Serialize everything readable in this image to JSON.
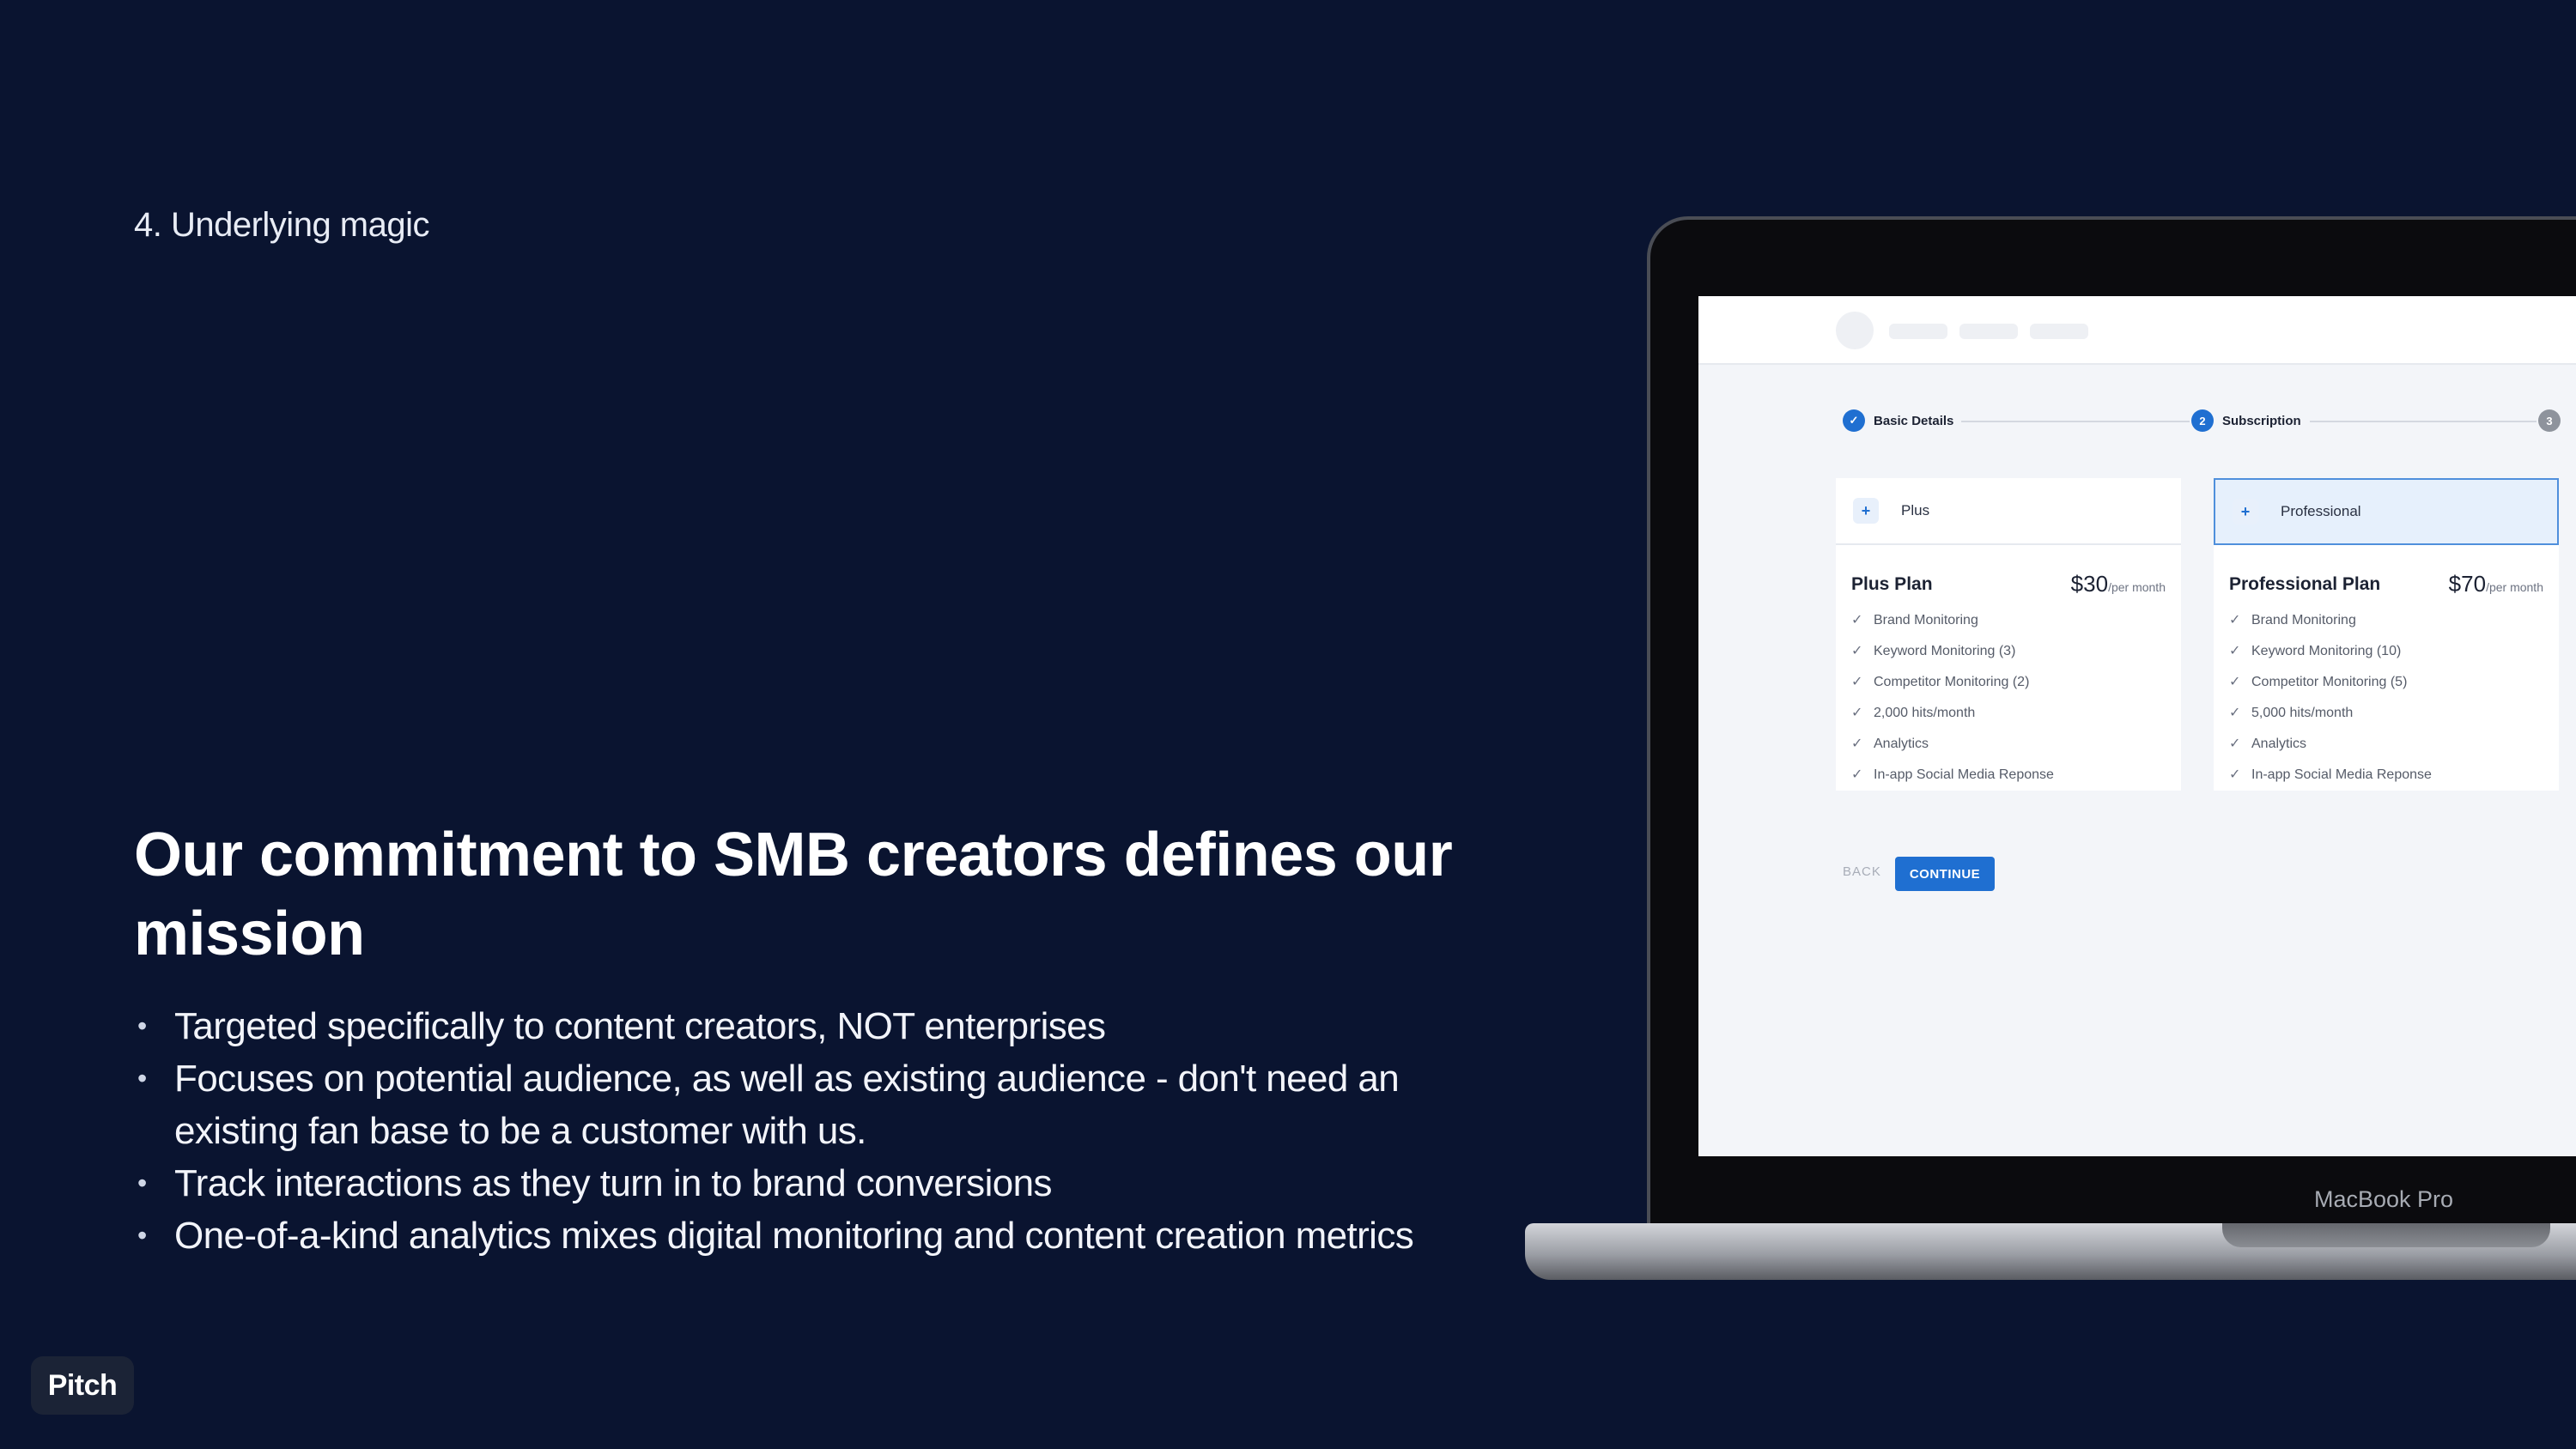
{
  "slide": {
    "eyebrow": "4. Underlying magic",
    "headline": "Our commitment to SMB creators defines our mission",
    "bullets": [
      "Targeted specifically to content creators, NOT enterprises",
      "Focuses on potential audience, as well as existing audience - don't need an existing fan base to be a customer with us.",
      "Track interactions as they turn in to brand conversions",
      "One-of-a-kind analytics mixes digital monitoring and content creation metrics"
    ]
  },
  "branding": {
    "logo": "Pitch"
  },
  "laptop": {
    "label": "MacBook Pro"
  },
  "app": {
    "steps": [
      {
        "number": "✓",
        "label": "Basic Details"
      },
      {
        "number": "2",
        "label": "Subscription"
      },
      {
        "number": "3",
        "label": ""
      }
    ],
    "plans": [
      {
        "tab_label": "Plus",
        "title": "Plus Plan",
        "price": "$30",
        "period": "/per month",
        "features": [
          "Brand Monitoring",
          "Keyword Monitoring (3)",
          "Competitor Monitoring (2)",
          "2,000 hits/month",
          "Analytics",
          "In-app Social Media Reponse"
        ]
      },
      {
        "tab_label": "Professional",
        "title": "Professional Plan",
        "price": "$70",
        "period": "/per month",
        "features": [
          "Brand Monitoring",
          "Keyword Monitoring (10)",
          "Competitor Monitoring (5)",
          "5,000 hits/month",
          "Analytics",
          "In-app Social Media Reponse"
        ]
      }
    ],
    "back_label": "BACK",
    "continue_label": "CONTINUE"
  },
  "colors": {
    "background": "#0a1430",
    "accent": "#1f6fd1"
  }
}
